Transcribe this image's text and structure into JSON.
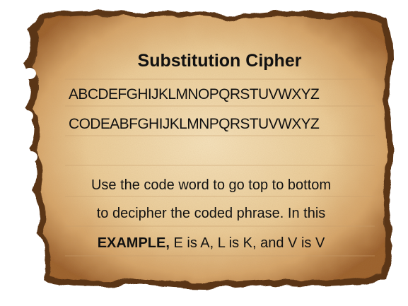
{
  "card": {
    "title": "Substitution Cipher",
    "plain_alphabet": "ABCDEFGHIJKLMNOPQRSTUVWXYZ",
    "cipher_alphabet": "CODEABFGHIJKLMNPQRSTUVWXYZ",
    "line1": "Use the code word to go top to bottom",
    "line2": "to decipher the coded phrase. In this",
    "line3_bold": "EXAMPLE,",
    "line3_rest": " E is A, L is K, and V is V"
  },
  "colors": {
    "parchment_light": "#f1d6a6",
    "parchment_mid": "#ddb27a",
    "parchment_dark": "#8a5528",
    "burnt_edge": "#4b2a12",
    "rule_line": "#c79e6d"
  }
}
